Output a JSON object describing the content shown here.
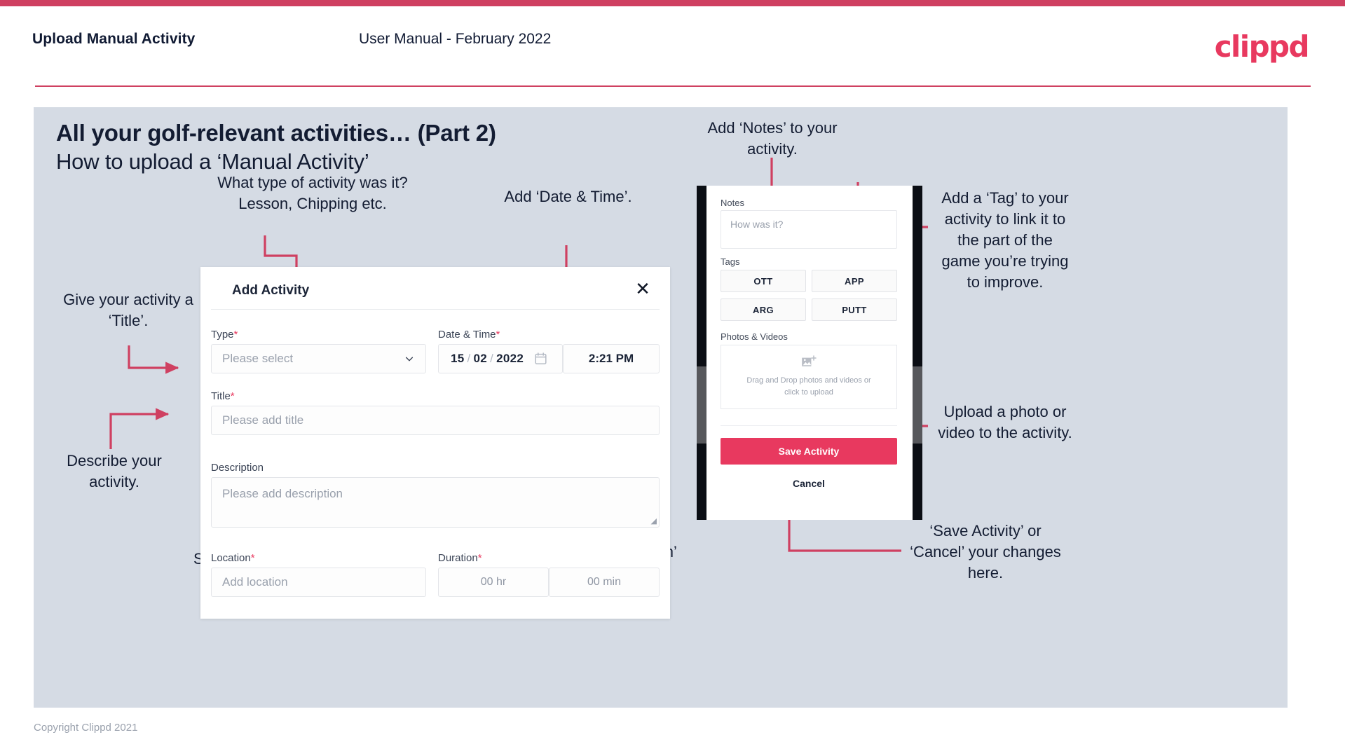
{
  "theme": {
    "accent": "#cf4061",
    "brand_pink": "#e8395f",
    "slide_bg": "#d5dbe4",
    "text_dark": "#131c32",
    "muted": "#9aa1ad"
  },
  "header": {
    "title": "Upload Manual Activity",
    "subtitle": "User Manual - February 2022",
    "logo": "clippd"
  },
  "slide": {
    "heading": "All your golf-relevant activities… (Part 2)",
    "subheading": "How to upload a ‘Manual Activity’"
  },
  "annotations": [
    {
      "id": "type",
      "text": "What type of activity was it?\nLesson, Chipping etc."
    },
    {
      "id": "datetime",
      "text": "Add ‘Date & Time’."
    },
    {
      "id": "title",
      "text": "Give your activity a\n‘Title’."
    },
    {
      "id": "describe",
      "text": "Describe your\nactivity."
    },
    {
      "id": "location",
      "text": "Specify the ‘Location’."
    },
    {
      "id": "duration",
      "text": "Specify the ‘Duration’\nof your activity."
    },
    {
      "id": "notes",
      "text": "Add ‘Notes’ to your\nactivity."
    },
    {
      "id": "tag",
      "text": "Add a ‘Tag’ to your\nactivity to link it to\nthe part of the\ngame you’re trying\nto improve."
    },
    {
      "id": "upload",
      "text": "Upload a photo or\nvideo to the activity."
    },
    {
      "id": "savecancel",
      "text": "‘Save Activity’ or\n‘Cancel’ your changes\nhere."
    }
  ],
  "dialog": {
    "title": "Add Activity",
    "close_icon": "close-icon",
    "fields": {
      "type": {
        "label": "Type",
        "required": "*",
        "placeholder": "Please select",
        "chevron_icon": "chevron-down-icon"
      },
      "datetime": {
        "label": "Date & Time",
        "required": "*",
        "day": "15",
        "month": "02",
        "year": "2022",
        "sep": "/",
        "calendar_icon": "calendar-icon",
        "time": "2:21 PM"
      },
      "title": {
        "label": "Title",
        "required": "*",
        "placeholder": "Please add title"
      },
      "description": {
        "label": "Description",
        "required": "",
        "placeholder": "Please add description"
      },
      "location": {
        "label": "Location",
        "required": "*",
        "placeholder": "Add location"
      },
      "duration": {
        "label": "Duration",
        "required": "*",
        "hours": "00 hr",
        "minutes": "00 min"
      }
    }
  },
  "phone": {
    "notes": {
      "label": "Notes",
      "placeholder": "How was it?"
    },
    "tags": {
      "label": "Tags",
      "items": [
        "OTT",
        "APP",
        "ARG",
        "PUTT"
      ]
    },
    "media": {
      "label": "Photos & Videos",
      "icon": "add-image-icon",
      "hint_line1": "Drag and Drop photos and videos or",
      "hint_line2": "click to upload"
    },
    "save_label": "Save Activity",
    "cancel_label": "Cancel"
  },
  "footer": {
    "copyright": "Copyright Clippd 2021"
  }
}
